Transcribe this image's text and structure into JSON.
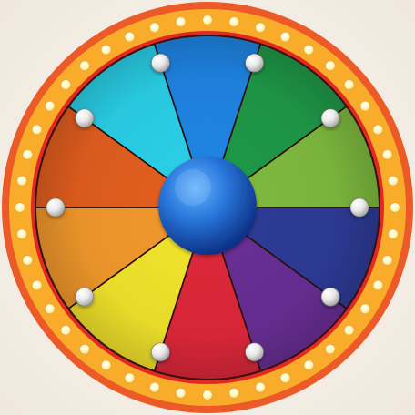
{
  "wheel": {
    "segments": [
      {
        "name": "blue",
        "color": "#1f86e6"
      },
      {
        "name": "green",
        "color": "#1f9a48"
      },
      {
        "name": "lime",
        "color": "#7fbc3f"
      },
      {
        "name": "indigo",
        "color": "#2e3c98"
      },
      {
        "name": "purple",
        "color": "#6a2f96"
      },
      {
        "name": "red",
        "color": "#e0283a"
      },
      {
        "name": "yellow",
        "color": "#f4e62c"
      },
      {
        "name": "orange",
        "color": "#f49a2c"
      },
      {
        "name": "dark-orange",
        "color": "#e55f1f"
      },
      {
        "name": "cyan",
        "color": "#2ad2ea"
      }
    ],
    "rim": {
      "outer_color": "#ec5a27",
      "band_color": "#f8ac2a",
      "bulb_color": "#fff4b0",
      "inner_color": "#e12a22"
    },
    "hub_color": "#1f63c7",
    "peg_color": "#f2f2f2"
  }
}
